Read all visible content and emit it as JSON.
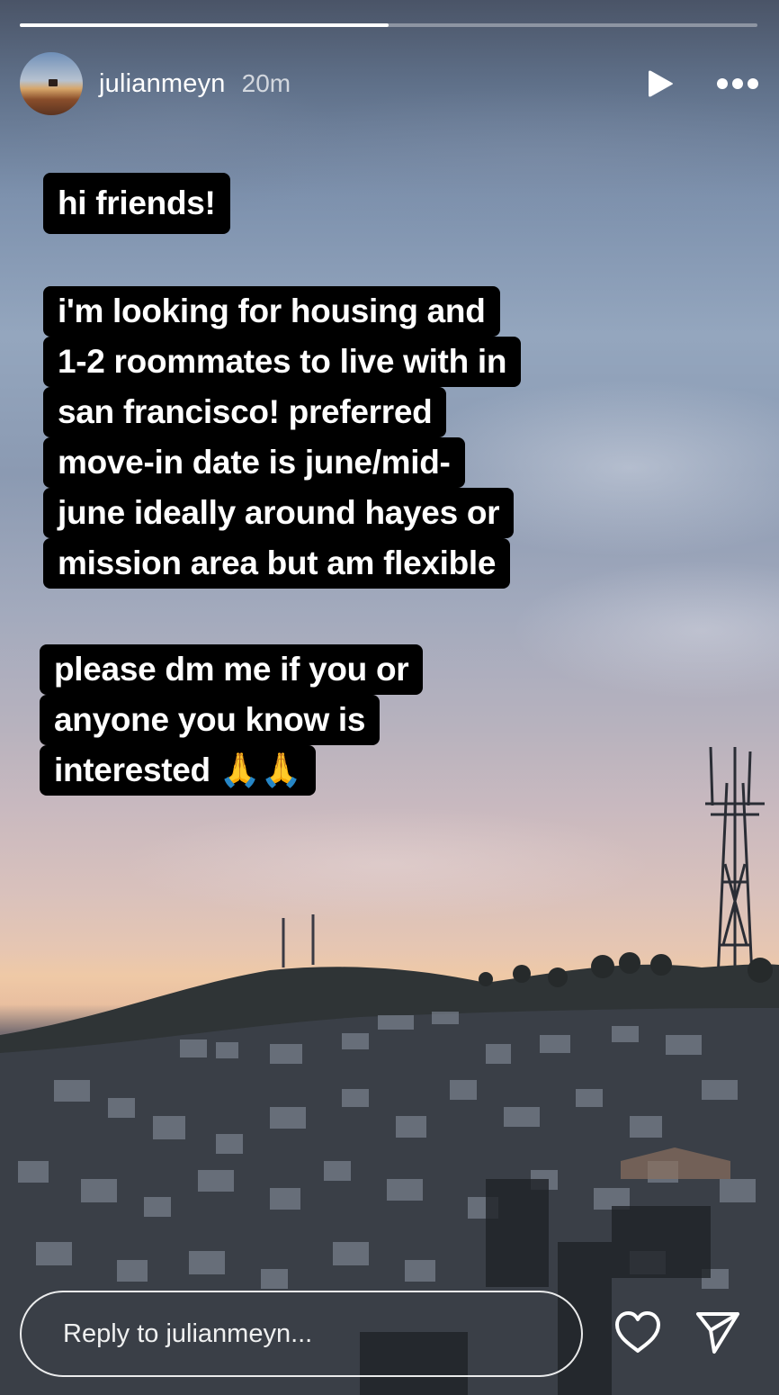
{
  "story": {
    "progress": 0.5,
    "username": "julianmeyn",
    "time_ago": "20m"
  },
  "captions": {
    "greeting": [
      "hi friends!"
    ],
    "body": [
      "i'm looking for housing and",
      "1-2 roommates to live with in",
      "san francisco! preferred",
      "move-in date is june/mid-",
      "june ideally around hayes or",
      "mission area but am flexible"
    ],
    "ask": [
      "please dm me if you or",
      "anyone you know is",
      "interested 🙏🙏"
    ]
  },
  "reply": {
    "placeholder": "Reply to julianmeyn..."
  },
  "icons": {
    "play": "play-icon",
    "more": "more-icon",
    "like": "heart-icon",
    "send": "send-icon"
  }
}
